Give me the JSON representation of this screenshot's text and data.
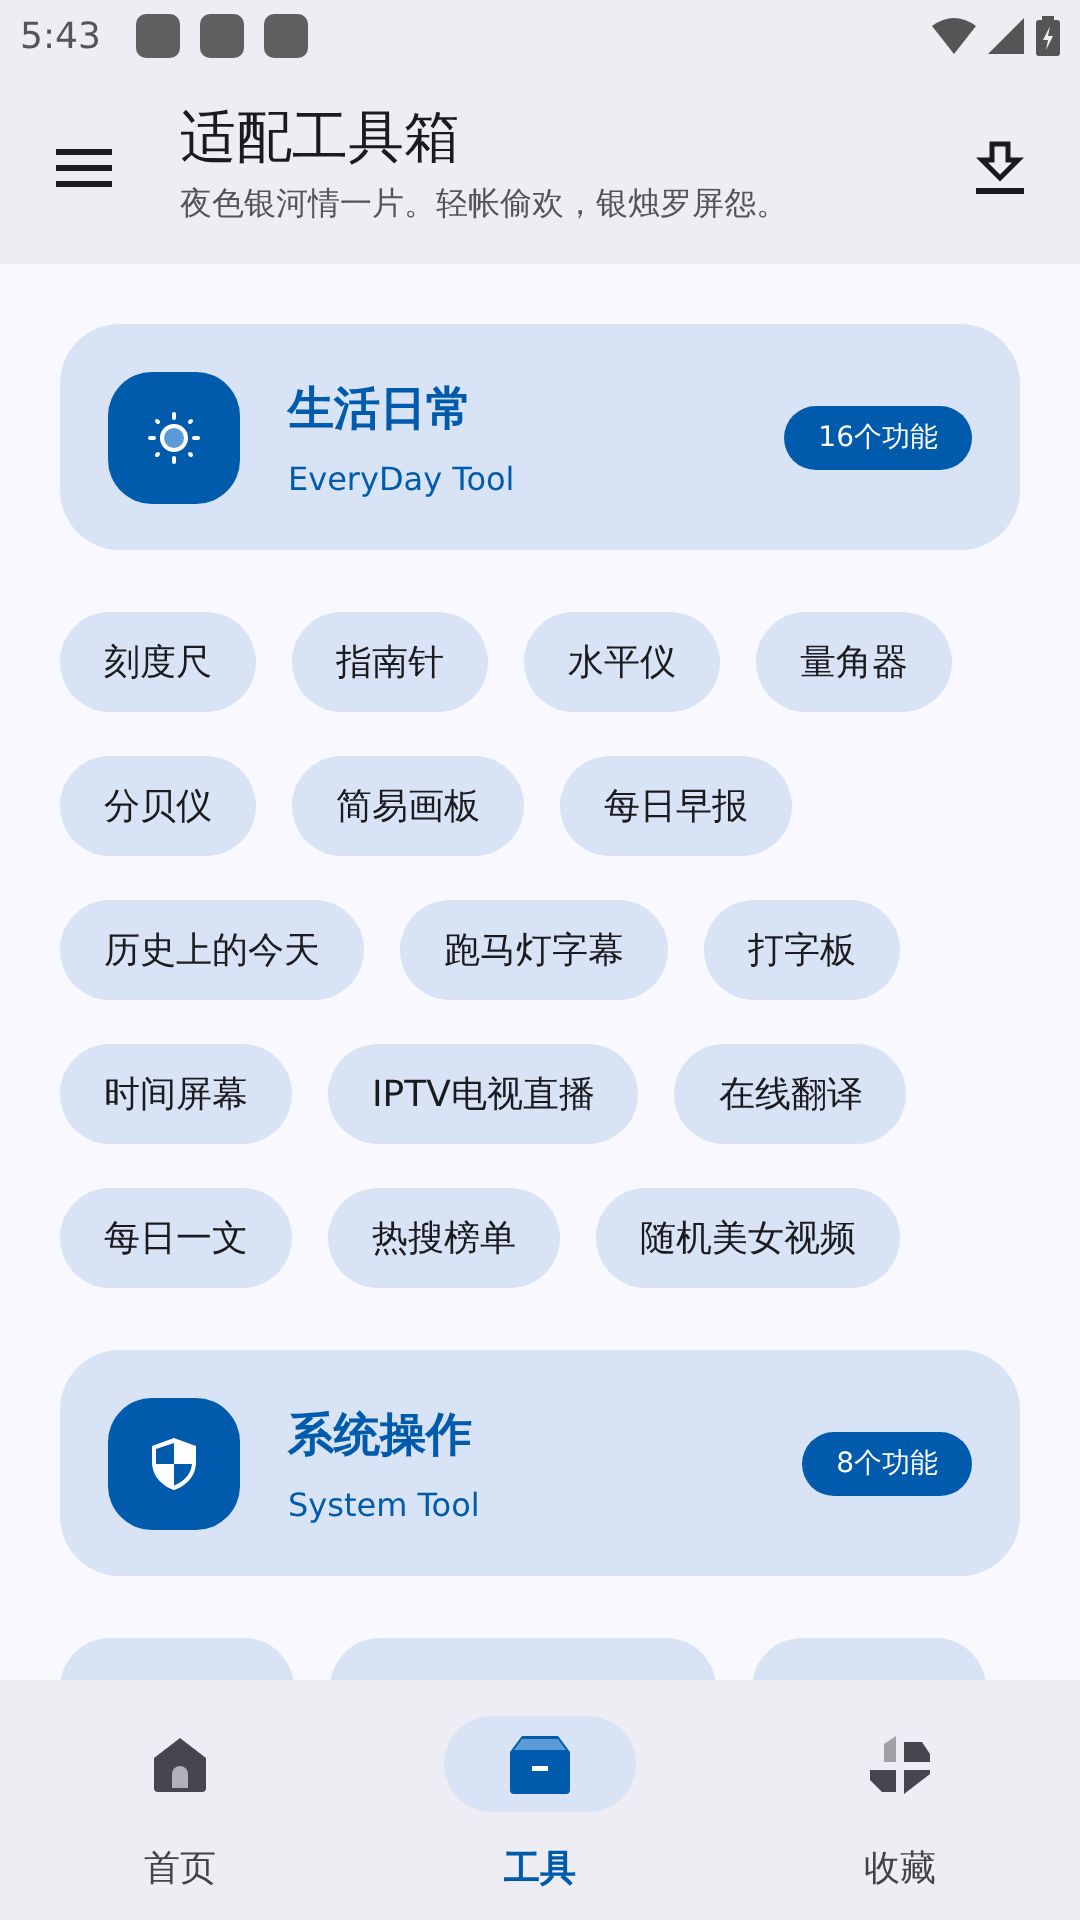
{
  "status_bar": {
    "time": "5:43"
  },
  "app_bar": {
    "title": "适配工具箱",
    "subtitle": "夜色银河情一片。轻帐偷欢，银烛罗屏怨。"
  },
  "sections": [
    {
      "kind": "sun",
      "title": "生活日常",
      "subtitle": "EveryDay Tool",
      "count": "16个功能",
      "tools": [
        "刻度尺",
        "指南针",
        "水平仪",
        "量角器",
        "分贝仪",
        "简易画板",
        "每日早报",
        "历史上的今天",
        "跑马灯字幕",
        "打字板",
        "时间屏幕",
        "IPTV电视直播",
        "在线翻译",
        "每日一文",
        "热搜榜单",
        "随机美女视频"
      ]
    },
    {
      "kind": "shield",
      "title": "系统操作",
      "subtitle": "System Tool",
      "count": "8个功能"
    }
  ],
  "nav": [
    {
      "kind": "home",
      "label": "首页",
      "selected": false
    },
    {
      "kind": "box",
      "label": "工具",
      "selected": true
    },
    {
      "kind": "star",
      "label": "收藏",
      "selected": false
    }
  ]
}
